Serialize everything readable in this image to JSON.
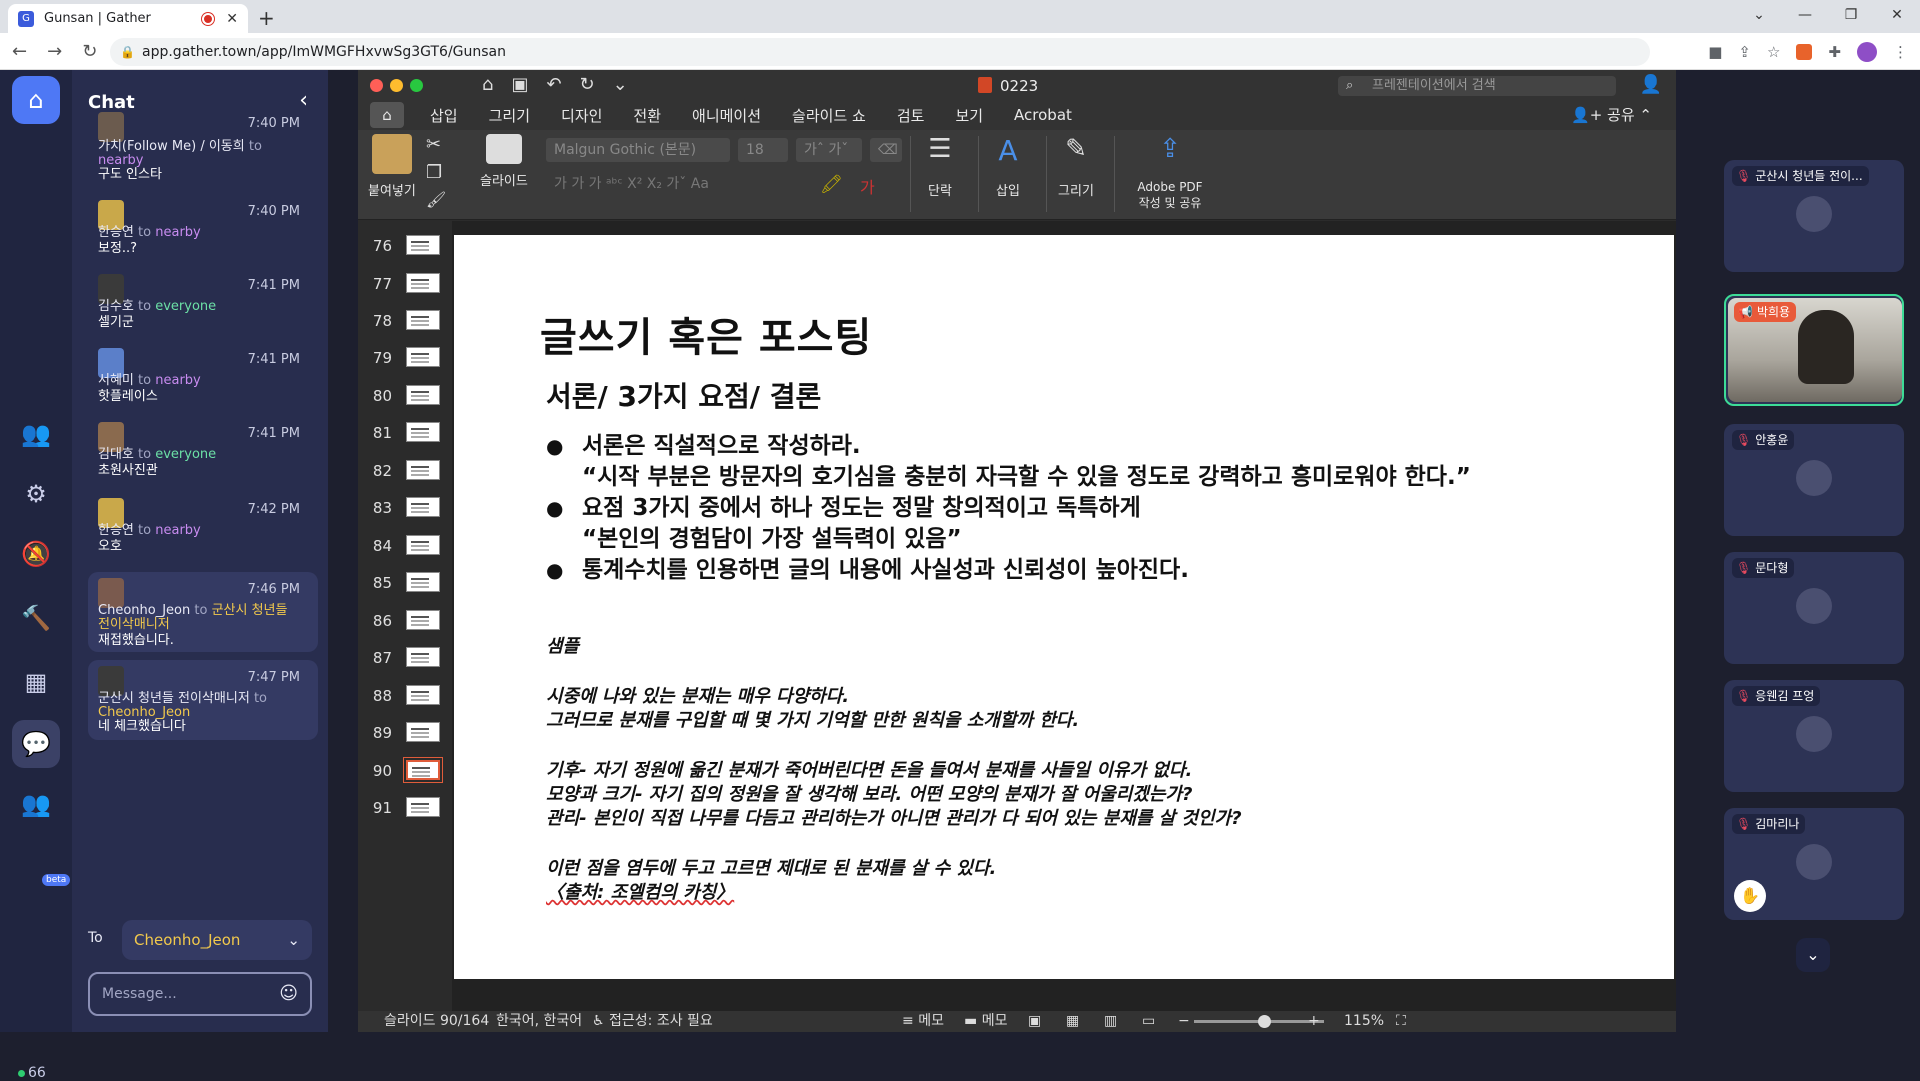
{
  "browser": {
    "tab_title": "Gunsan | Gather",
    "new_tab": "+",
    "url": "app.gather.town/app/ImWMGFHxvwSg3GT6/Gunsan"
  },
  "rail": {
    "beta": "beta",
    "online_count": "66"
  },
  "chat": {
    "title": "Chat",
    "messages": [
      {
        "time": "7:40 PM",
        "from": "가치(Follow Me) / 이동희",
        "to_word": "to",
        "to": "nearby",
        "body": "구도 인스타"
      },
      {
        "time": "7:40 PM",
        "from": "한승연",
        "to_word": "to",
        "to": "nearby",
        "body": "보정..?"
      },
      {
        "time": "7:41 PM",
        "from": "김수호",
        "to_word": "to",
        "to": "everyone",
        "body": "셀기군"
      },
      {
        "time": "7:41 PM",
        "from": "서혜미",
        "to_word": "to",
        "to": "nearby",
        "body": "핫플레이스"
      },
      {
        "time": "7:41 PM",
        "from": "김대호",
        "to_word": "to",
        "to": "everyone",
        "body": "초원사진관"
      },
      {
        "time": "7:42 PM",
        "from": "한승연",
        "to_word": "to",
        "to": "nearby",
        "body": "오호"
      },
      {
        "time": "7:46 PM",
        "from": "Cheonho_Jeon",
        "to_word": "to",
        "to": "군산시 청년들 전이삭매니저",
        "body": "재접했습니다."
      },
      {
        "time": "7:47 PM",
        "from": "군산시 청년들 전이삭매니저",
        "to_word": "to",
        "to": "Cheonho_Jeon",
        "body": "네 체크했습니다"
      }
    ],
    "to_label": "To",
    "to_value": "Cheonho_Jeon",
    "message_placeholder": "Message..."
  },
  "ppt": {
    "doc_name": "0223",
    "search_placeholder": "프레젠테이션에서 검색",
    "tabs": [
      "삽입",
      "그리기",
      "디자인",
      "전환",
      "애니메이션",
      "슬라이드 쇼",
      "검토",
      "보기",
      "Acrobat"
    ],
    "share": "공유",
    "ribbon": {
      "paste": "붙여넣기",
      "slide": "슬라이드",
      "font": "Malgun Gothic (본문)",
      "font_size": "18",
      "paragraph": "단락",
      "insert": "삽입",
      "draw": "그리기",
      "adobe": "Adobe PDF",
      "adobe2": "작성 및 공유"
    },
    "thumb_numbers": [
      "76",
      "77",
      "78",
      "79",
      "80",
      "81",
      "82",
      "83",
      "84",
      "85",
      "86",
      "87",
      "88",
      "89",
      "90",
      "91"
    ],
    "slide": {
      "title": "글쓰기 혹은 포스팅",
      "subtitle": "서론/ 3가지 요점/ 결론",
      "bullet1": "서론은 직설적으로 작성하라.",
      "bullet1b": "“시작 부분은 방문자의 호기심을 충분히 자극할 수 있을 정도로 강력하고 흥미로워야 한다.”",
      "bullet2": "요점 3가지 중에서 하나 정도는 정말 창의적이고 독특하게",
      "bullet2b": "“본인의 경험담이 가장 설득력이 있음”",
      "bullet3": "통계수치를 인용하면 글의 내용에 사실성과 신뢰성이 높아진다.",
      "sample_title": "샘플",
      "p1a": "시중에 나와 있는 분재는 매우 다양하다.",
      "p1b": "그러므로 분재를 구입할 때 몇 가지 기억할 만한 원칙을 소개할까 한다.",
      "p2a": "기후- 자기 정원에 옮긴 분재가 죽어버린다면 돈을 들여서 분재를 사들일 이유가 없다.",
      "p2b": "모양과 크기- 자기 집의 정원을 잘 생각해 보라. 어떤 모양의 분재가 잘 어울리겠는가?",
      "p2c": "관리- 본인이 직접 나무를 다듬고 관리하는가 아니면 관리가 다 되어 있는 분재를 살 것인가?",
      "p3a": "이런 점을 염두에 두고 고르면 제대로 된 분재를 살 수 있다.",
      "p3b": "〈출처: 조엘컴의 카칭〉"
    },
    "status": {
      "slide_count": "슬라이드 90/164",
      "lang": "한국어, 한국어",
      "access": "접근성: 조사 필요",
      "notes": "메모",
      "comments": "메모",
      "zoom": "115%"
    }
  },
  "participants": [
    {
      "name": "군산시 청년들 전이...",
      "speaking": false
    },
    {
      "name": "박희용",
      "speaking": true
    },
    {
      "name": "안홍윤",
      "speaking": false
    },
    {
      "name": "문다형",
      "speaking": false
    },
    {
      "name": "응웬김 프엉",
      "speaking": false
    },
    {
      "name": "김마리나",
      "speaking": false
    }
  ]
}
